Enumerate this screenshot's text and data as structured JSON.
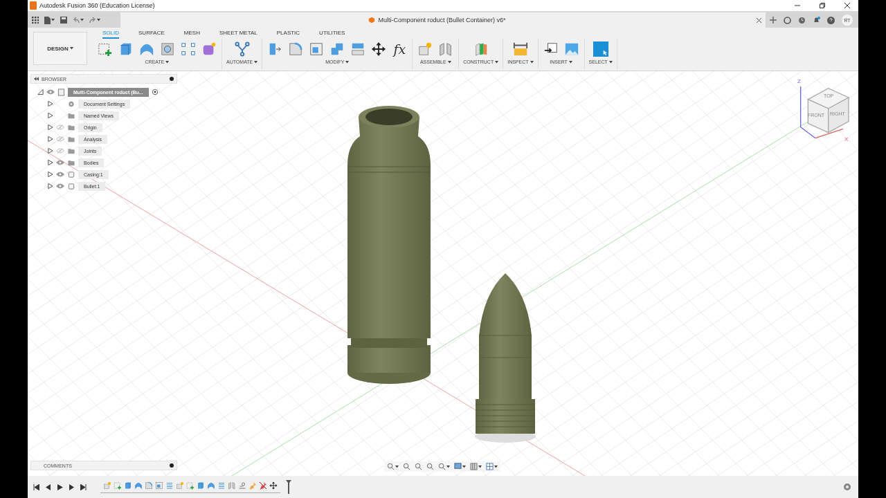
{
  "window": {
    "title": "Autodesk Fusion 360 (Education License)"
  },
  "document_tab": {
    "title": "Multi-Component roduct (Bullet Container) v6*"
  },
  "user": {
    "initials": "RT"
  },
  "workspace": {
    "label": "DESIGN"
  },
  "tabs": [
    {
      "label": "SOLID",
      "selected": true
    },
    {
      "label": "SURFACE",
      "selected": false
    },
    {
      "label": "MESH",
      "selected": false
    },
    {
      "label": "SHEET METAL",
      "selected": false
    },
    {
      "label": "PLASTIC",
      "selected": false
    },
    {
      "label": "UTILITIES",
      "selected": false
    }
  ],
  "tool_groups": [
    {
      "label": "CREATE",
      "tools": [
        {
          "kind": "sketch"
        },
        {
          "kind": "extrude"
        },
        {
          "kind": "revolve"
        },
        {
          "kind": "hole"
        },
        {
          "kind": "pattern"
        },
        {
          "kind": "form"
        }
      ]
    },
    {
      "label": "AUTOMATE",
      "tools": [
        {
          "kind": "automate"
        }
      ]
    },
    {
      "label": "MODIFY",
      "tools": [
        {
          "kind": "presspull"
        },
        {
          "kind": "fillet"
        },
        {
          "kind": "shell"
        },
        {
          "kind": "combine"
        },
        {
          "kind": "split"
        },
        {
          "kind": "move"
        },
        {
          "kind": "parameters",
          "glyph": "fx"
        }
      ]
    },
    {
      "label": "ASSEMBLE",
      "tools": [
        {
          "kind": "component"
        },
        {
          "kind": "joint"
        }
      ]
    },
    {
      "label": "CONSTRUCT",
      "tools": [
        {
          "kind": "plane"
        }
      ]
    },
    {
      "label": "INSPECT",
      "tools": [
        {
          "kind": "measure"
        }
      ]
    },
    {
      "label": "INSERT",
      "tools": [
        {
          "kind": "insert"
        },
        {
          "kind": "image"
        }
      ]
    },
    {
      "label": "SELECT",
      "tools": [
        {
          "kind": "select"
        }
      ]
    }
  ],
  "browser": {
    "title": "BROWSER",
    "root": {
      "label": "Multi-Component roduct (Bu...",
      "expanded": true,
      "selected": true
    },
    "items": [
      {
        "label": "Document Settings",
        "kind": "settings",
        "expanded": false
      },
      {
        "label": "Named Views",
        "kind": "folder",
        "expanded": false
      },
      {
        "label": "Origin",
        "kind": "folder",
        "visible": false,
        "expanded": false
      },
      {
        "label": "Analysis",
        "kind": "folder",
        "visible": false,
        "expanded": false
      },
      {
        "label": "Joints",
        "kind": "folder",
        "visible": false,
        "expanded": false
      },
      {
        "label": "Bodies",
        "kind": "folder",
        "visible": true,
        "expanded": false
      },
      {
        "label": "Casing:1",
        "kind": "component",
        "visible": true,
        "expanded": false
      },
      {
        "label": "Bullet:1",
        "kind": "component",
        "visible": true,
        "expanded": false
      }
    ]
  },
  "comments": {
    "title": "COMMENTS"
  },
  "view_cube": {
    "top": "TOP",
    "front": "FRONT",
    "right": "RIGHT",
    "z_axis": "Z",
    "x_axis": "X"
  },
  "timeline": {
    "features": [
      {
        "kind": "component"
      },
      {
        "kind": "sketch"
      },
      {
        "kind": "extrude"
      },
      {
        "kind": "revolve"
      },
      {
        "kind": "fillet"
      },
      {
        "kind": "shell"
      },
      {
        "kind": "thread"
      },
      {
        "kind": "component"
      },
      {
        "kind": "sketch"
      },
      {
        "kind": "extrude"
      },
      {
        "kind": "revolve"
      },
      {
        "kind": "thread"
      },
      {
        "kind": "joint"
      },
      {
        "kind": "asbuilt"
      },
      {
        "kind": "pin"
      },
      {
        "kind": "unpin"
      },
      {
        "kind": "move"
      }
    ]
  }
}
